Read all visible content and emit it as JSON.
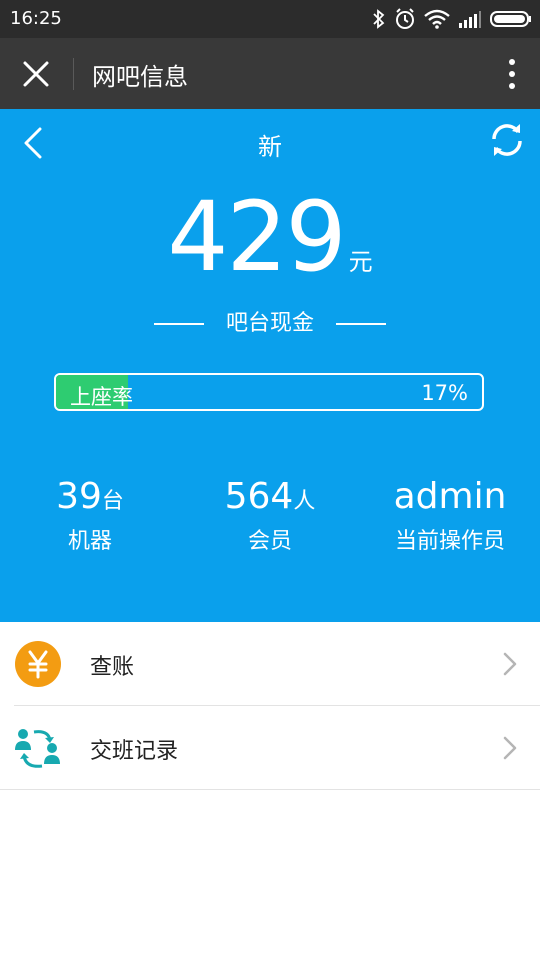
{
  "status_bar": {
    "time": "16:25",
    "icons": [
      "bluetooth-icon",
      "alarm-icon",
      "wifi-icon",
      "signal-icon",
      "battery-icon"
    ]
  },
  "title_bar": {
    "title": "网吧信息",
    "close_icon": "close-icon",
    "more_icon": "more-vertical-icon"
  },
  "header": {
    "title": "新",
    "amount": "429",
    "amount_unit": "元",
    "cash_label": "吧台现金",
    "occupancy": {
      "label": "上座率",
      "value_text": "17%",
      "fraction": 0.17
    },
    "stats": [
      {
        "value": "39",
        "unit": "台",
        "caption": "机器"
      },
      {
        "value": "564",
        "unit": "人",
        "caption": "会员"
      },
      {
        "value": "admin",
        "unit": "",
        "caption": "当前操作员"
      }
    ]
  },
  "menu": [
    {
      "label": "查账",
      "icon": "yen-coin-icon"
    },
    {
      "label": "交班记录",
      "icon": "shift-exchange-icon"
    }
  ],
  "colors": {
    "header_blue": "#0aa0ec",
    "progress_green": "#2ecc71",
    "coin_orange": "#f39c12",
    "exchange_teal": "#17a9b0"
  }
}
